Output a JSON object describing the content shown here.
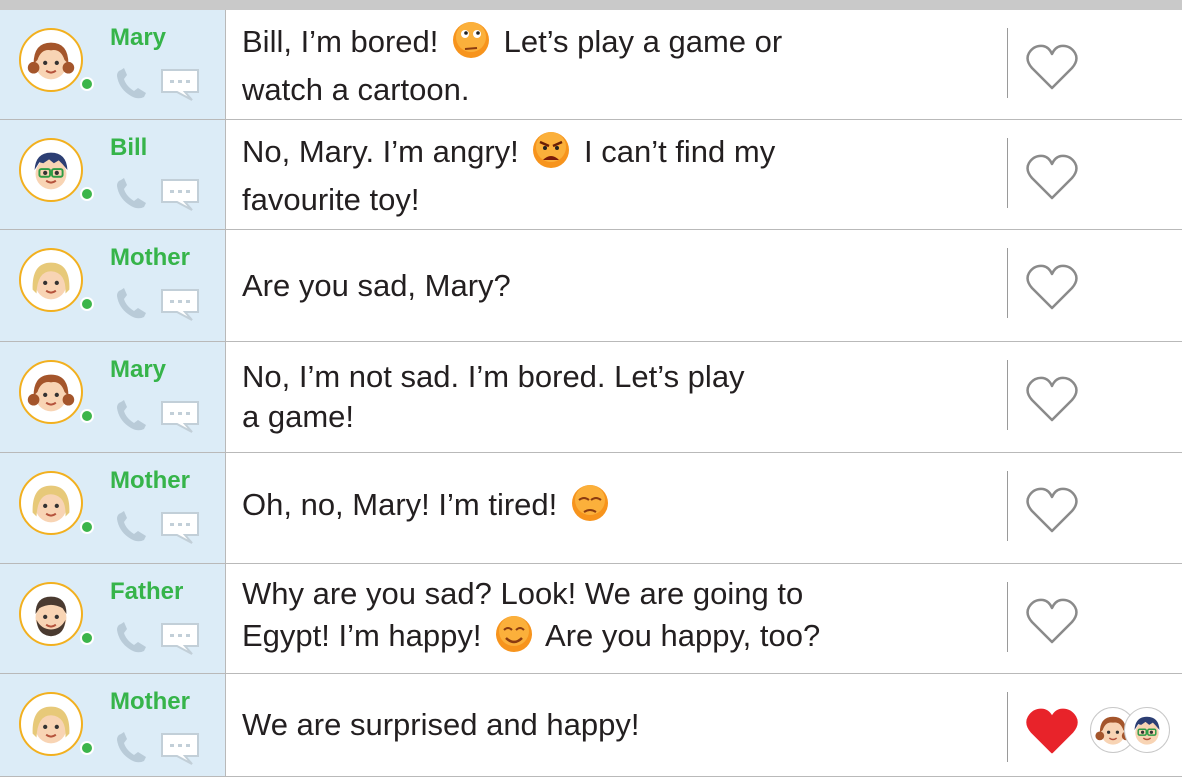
{
  "messages": [
    {
      "sender": "Mary",
      "avatar": "mary-avatar",
      "parts": [
        "Bill, I’m bored! ",
        "emoji:bored",
        " Let’s play a game or\nwatch a cartoon."
      ],
      "liked": false
    },
    {
      "sender": "Bill",
      "avatar": "bill-avatar",
      "parts": [
        "No, Mary. I’m angry! ",
        "emoji:angry",
        " I can’t find my\nfavourite toy!"
      ],
      "liked": false
    },
    {
      "sender": "Mother",
      "avatar": "mother-avatar",
      "parts": [
        "Are you sad, Mary?"
      ],
      "liked": false
    },
    {
      "sender": "Mary",
      "avatar": "mary-avatar",
      "parts": [
        "No, I’m not sad. I’m bored. Let’s play\na game!"
      ],
      "liked": false
    },
    {
      "sender": "Mother",
      "avatar": "mother-avatar",
      "parts": [
        "Oh, no, Mary! I’m tired! ",
        "emoji:tired"
      ],
      "liked": false
    },
    {
      "sender": "Father",
      "avatar": "father-avatar",
      "parts": [
        "Why are you sad? Look! We are going to\nEgypt! I’m happy! ",
        "emoji:happy",
        " Are you happy, too?"
      ],
      "liked": false
    },
    {
      "sender": "Mother",
      "avatar": "mother-avatar",
      "parts": [
        "We are surprised and happy!"
      ],
      "liked": true,
      "liked_by": [
        "mary-avatar",
        "bill-avatar"
      ]
    }
  ],
  "icons": {
    "phone": "phone-icon",
    "sms": "sms-icon",
    "like": "heart-icon"
  },
  "colors": {
    "sender_bg": "#dcecf7",
    "name": "#36b44a",
    "avatar_ring": "#f2b01f",
    "online": "#3cb54a",
    "heart_filled": "#e8232a",
    "heart_outline": "#8a8a8a"
  }
}
